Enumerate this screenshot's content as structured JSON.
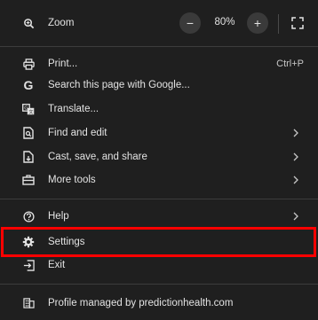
{
  "zoom": {
    "label": "Zoom",
    "minus": "−",
    "value": "80%",
    "plus": "+"
  },
  "items": [
    {
      "label": "Print...",
      "shortcut": "Ctrl+P"
    },
    {
      "label": "Search this page with Google..."
    },
    {
      "label": "Translate..."
    },
    {
      "label": "Find and edit"
    },
    {
      "label": "Cast, save, and share"
    },
    {
      "label": "More tools"
    },
    {
      "label": "Help"
    },
    {
      "label": "Settings"
    },
    {
      "label": "Exit"
    },
    {
      "label": "Profile managed by predictionhealth.com"
    }
  ],
  "colors": {
    "background": "#1f1f1f",
    "text": "#e3e3e3",
    "highlight_border": "#ff0000"
  }
}
